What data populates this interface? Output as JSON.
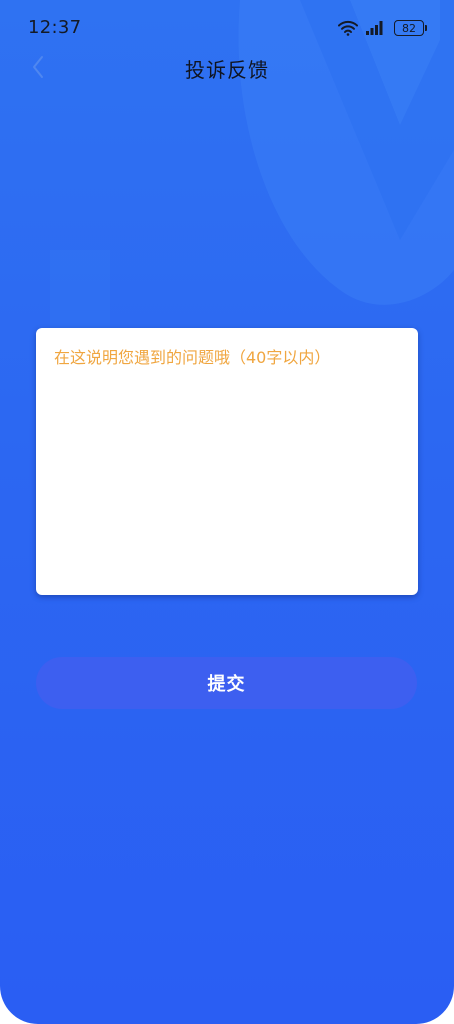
{
  "status_bar": {
    "time": "12:37",
    "battery_level": "82",
    "wifi_icon": "wifi-icon",
    "signal_icon": "cellular-signal-icon",
    "battery_icon": "battery-icon"
  },
  "nav": {
    "back_icon": "chevron-left-icon",
    "title": "投诉反馈"
  },
  "feedback": {
    "value": "",
    "placeholder": "在这说明您遇到的问题哦（40字以内）"
  },
  "actions": {
    "submit_label": "提交"
  },
  "colors": {
    "background_top": "#2f72f2",
    "background_bottom": "#2a5ef3",
    "placeholder": "#f0a640",
    "submit_button": "#3d5ff0",
    "card": "#ffffff"
  }
}
